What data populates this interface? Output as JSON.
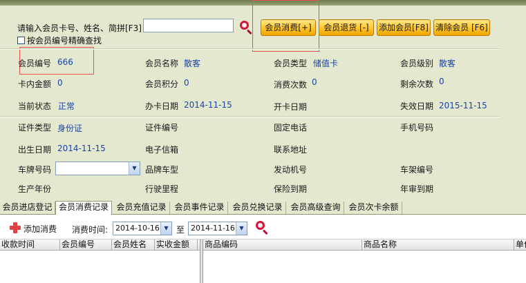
{
  "search": {
    "label": "请输入会员卡号、姓名、简拼[F3]",
    "value": "",
    "exact_label": "按会员编号精确查找"
  },
  "toolbar": {
    "consume": "会员消费[+]",
    "refund": "会员退货 [-]",
    "add_member": "添加会员[F8]",
    "clear_member": "清除会员 [F6]"
  },
  "member": {
    "id_label": "会员编号",
    "id_value": "666",
    "name_label": "会员名称",
    "name_value": "散客",
    "type_label": "会员类型",
    "type_value": "储值卡",
    "level_label": "会员级别",
    "level_value": "散客",
    "balance_label": "卡内金额",
    "balance_value": "0",
    "points_label": "会员积分",
    "points_value": "0",
    "consume_count_label": "消费次数",
    "consume_count_value": "0",
    "remaining_count_label": "剩余次数",
    "remaining_count_value": "0",
    "status_label": "当前状态",
    "status_value": "正常",
    "issue_date_label": "办卡日期",
    "issue_date_value": "2014-11-15",
    "open_date_label": "开卡日期",
    "open_date_value": "",
    "expire_date_label": "失效日期",
    "expire_date_value": "2015-11-15",
    "cert_type_label": "证件类型",
    "cert_type_value": "身份证",
    "cert_no_label": "证件编号",
    "cert_no_value": "",
    "phone_label": "固定电话",
    "phone_value": "",
    "mobile_label": "手机号码",
    "mobile_value": "",
    "birth_label": "出生日期",
    "birth_value": "2014-11-15",
    "email_label": "电子信箱",
    "email_value": "",
    "address_label": "联系地址",
    "address_value": "",
    "plate_label": "车牌号码",
    "plate_value": "",
    "brand_label": "品牌车型",
    "brand_value": "",
    "engine_label": "发动机号",
    "engine_value": "",
    "frame_label": "车架编号",
    "frame_value": "",
    "year_label": "生产年份",
    "year_value": "",
    "mileage_label": "行驶里程",
    "mileage_value": "",
    "insurance_label": "保险到期",
    "insurance_value": "",
    "inspection_label": "年审到期",
    "inspection_value": ""
  },
  "tabs": [
    "会员进店登记",
    "会员消费记录",
    "会员充值记录",
    "会员事件记录",
    "会员兑换记录",
    "会员高级查询",
    "会员次卡余额"
  ],
  "records": {
    "add_label": "添加消费",
    "time_label": "消费时间:",
    "date_from": "2014-10-16",
    "to_label": "至",
    "date_to": "2014-11-16",
    "left_columns": [
      "收款时间",
      "会员编号",
      "会员姓名",
      "实收金额"
    ],
    "right_columns": [
      "商品编码",
      "商品名称",
      "单价"
    ]
  },
  "colors": {
    "value_text": "#1a44a8",
    "button_gold": "#ffc52a",
    "panel_bg": "#e3e8cf",
    "highlight_box": "#e85050"
  }
}
